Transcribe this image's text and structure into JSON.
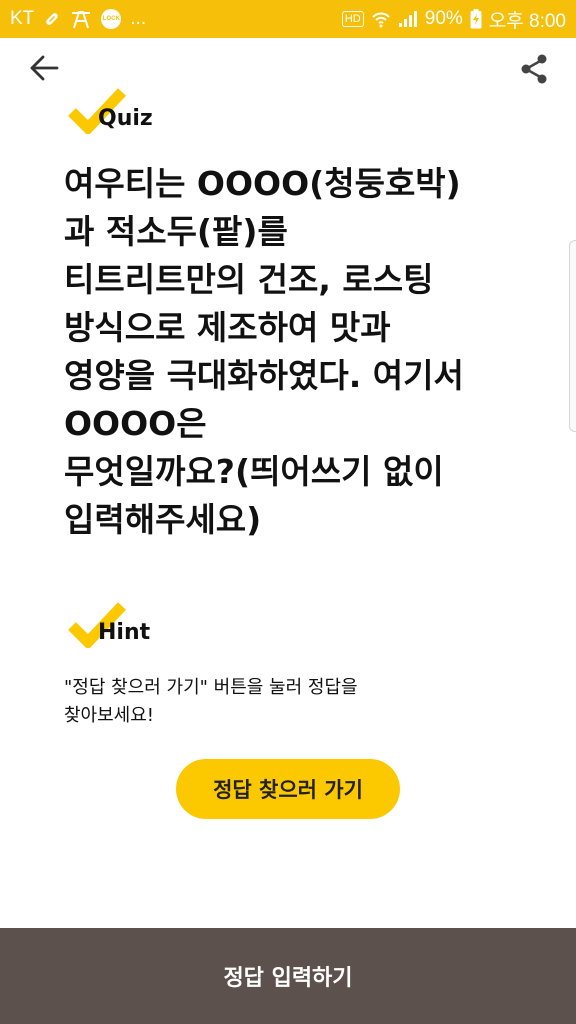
{
  "status_bar": {
    "carrier": "KT",
    "overflow": "...",
    "battery": "90%",
    "time": "오후 8:00",
    "hd": "HD",
    "lock_text": "LOCK",
    "icons": [
      "pill-icon",
      "tower-icon",
      "lock-app-icon",
      "hd-icon",
      "wifi-icon",
      "signal-icon",
      "battery-charging-icon"
    ]
  },
  "toolbar": {
    "back_icon": "arrow-left-icon",
    "share_icon": "share-icon"
  },
  "quiz": {
    "label": "Quiz",
    "question": "여우티는 OOOO(청둥호박)\n과 적소두(팥)를\n티트리트만의 건조, 로스팅\n방식으로 제조하여 맛과\n영양을 극대화하였다. 여기서\nOOOO은\n무엇일까요?(띄어쓰기 없이\n입력해주세요)"
  },
  "hint": {
    "label": "Hint",
    "text": "\"정답 찾으러 가기\" 버튼을 눌러 정답을\n찾아보세요!",
    "button_label": "정답 찾으러 가기"
  },
  "footer": {
    "submit_label": "정답 입력하기"
  },
  "colors": {
    "accent": "#fcc800",
    "status_bar": "#f6bf0a",
    "footer": "#5d514d"
  }
}
